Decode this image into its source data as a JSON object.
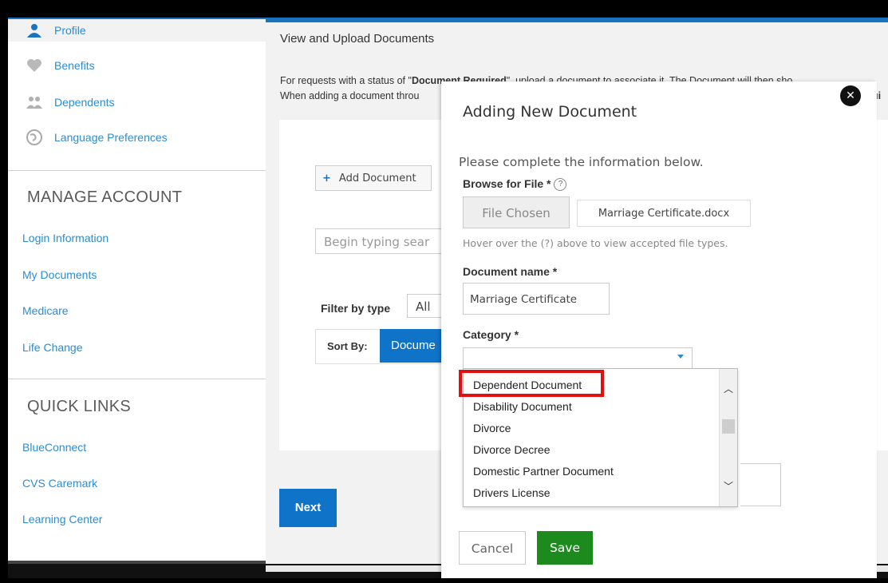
{
  "sidebar": {
    "nav_items": [
      {
        "label": "Profile",
        "icon": "profile-icon"
      },
      {
        "label": "Benefits",
        "icon": "heart-icon"
      },
      {
        "label": "Dependents",
        "icon": "people-icon"
      },
      {
        "label": "Language Preferences",
        "icon": "globe-icon"
      }
    ],
    "manage_account": {
      "title": "MANAGE ACCOUNT",
      "links": [
        "Login Information",
        "My Documents",
        "Medicare",
        "Life Change"
      ]
    },
    "quick_links": {
      "title": "QUICK LINKS",
      "links": [
        "BlueConnect",
        "CVS Caremark",
        "Learning Center"
      ]
    }
  },
  "main": {
    "title": "View and Upload Documents",
    "desc_line1_pre": "For requests with a status of \"",
    "desc_line1_bold": "Document Required",
    "desc_line1_post": "\", upload a document to associate it. The Document will then sho",
    "desc_line2": "When adding a document throu",
    "desc_line2_tail": "ui",
    "add_document": "Add Document",
    "search_placeholder": "Begin typing sear",
    "filter_label": "Filter by type",
    "filter_value": "All",
    "sort_label": "Sort By:",
    "sort_value": "Docume",
    "next": "Next"
  },
  "modal": {
    "title": "Adding New Document",
    "close": "✕",
    "intro": "Please complete the information below.",
    "browse_label": "Browse for File *",
    "help": "?",
    "file_button": "File Chosen",
    "file_name": "Marriage Certificate.docx",
    "file_hint": "Hover over the (?) above to view accepted file types.",
    "docname_label": "Document name *",
    "docname_value": "Marriage Certificate",
    "category_label": "Category *",
    "category_options": [
      "Dependent Document",
      "Disability Document",
      "Divorce",
      "Divorce Decree",
      "Domestic Partner Document",
      "Drivers License"
    ],
    "cancel": "Cancel",
    "save": "Save"
  },
  "colors": {
    "accent_blue": "#0f73c8",
    "link_blue": "#2a8dd4",
    "save_green": "#1c8a1c",
    "highlight_red": "#e01010"
  }
}
